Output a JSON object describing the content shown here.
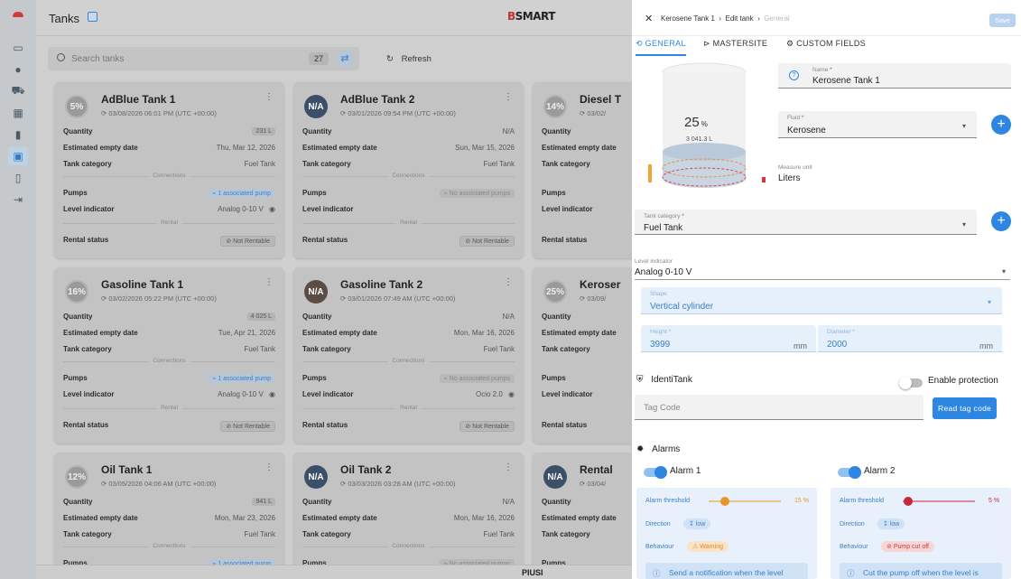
{
  "header": {
    "title": "Tanks",
    "brand_prefix": "B",
    "brand_main": "SMART"
  },
  "search": {
    "placeholder": "Search tanks",
    "count": "27",
    "refresh_label": "Refresh"
  },
  "sidebar": {
    "items": [
      "home-icon",
      "monitor-icon",
      "user-icon",
      "truck-icon",
      "building-icon",
      "chart-icon",
      "tank-icon",
      "map-icon",
      "export-icon"
    ],
    "active_index": 6
  },
  "labels": {
    "quantity": "Quantity",
    "empty_date": "Estimated empty date",
    "category": "Tank category",
    "connections": "Connections",
    "pumps": "Pumps",
    "level": "Level indicator",
    "rental": "Rental",
    "rental_status": "Rental status"
  },
  "cards": [
    {
      "badge": "5%",
      "badge_type": "pct",
      "name": "AdBlue Tank 1",
      "date": "03/08/2026 06:01 PM (UTC +00:00)",
      "quantity": "231 L",
      "empty_date": "Thu, Mar 12, 2026",
      "category": "Fuel Tank",
      "pumps": "1 associated pump",
      "pump_assoc": true,
      "level": "Analog 0-10 V",
      "rental": "Not Rentable"
    },
    {
      "badge": "N/A",
      "badge_type": "na",
      "name": "AdBlue Tank 2",
      "date": "03/01/2026 09:54 PM (UTC +00:00)",
      "quantity": "N/A",
      "empty_date": "Sun, Mar 15, 2026",
      "category": "Fuel Tank",
      "pumps": "No associated pumps",
      "pump_assoc": false,
      "level": "",
      "rental": "Not Rentable"
    },
    {
      "badge": "14%",
      "badge_type": "pct",
      "name": "Diesel T",
      "date": "03/02/",
      "quantity": "",
      "empty_date": "",
      "category": "",
      "pumps": "",
      "pump_assoc": false,
      "level": "",
      "rental": "",
      "partial": true
    },
    {
      "badge": "16%",
      "badge_type": "pct",
      "name": "Gasoline Tank 1",
      "date": "03/02/2026 05:22 PM (UTC +00:00)",
      "quantity": "4 025 L",
      "empty_date": "Tue, Apr 21, 2026",
      "category": "Fuel Tank",
      "pumps": "1 associated pump",
      "pump_assoc": true,
      "level": "Analog 0-10 V",
      "rental": "Not Rentable"
    },
    {
      "badge": "N/A",
      "badge_type": "na brown",
      "name": "Gasoline Tank 2",
      "date": "03/01/2026 07:49 AM (UTC +00:00)",
      "quantity": "N/A",
      "empty_date": "Mon, Mar 16, 2026",
      "category": "Fuel Tank",
      "pumps": "No associated pumps",
      "pump_assoc": false,
      "level": "Ocio 2.0",
      "rental": "Not Rentable"
    },
    {
      "badge": "25%",
      "badge_type": "pct",
      "name": "Keroser",
      "date": "03/09/",
      "quantity": "",
      "empty_date": "",
      "category": "",
      "pumps": "",
      "pump_assoc": false,
      "level": "",
      "rental": "",
      "partial": true
    },
    {
      "badge": "12%",
      "badge_type": "pct",
      "name": "Oil Tank 1",
      "date": "03/05/2026 04:06 AM (UTC +00:00)",
      "quantity": "941 L",
      "empty_date": "Mon, Mar 23, 2026",
      "category": "Fuel Tank",
      "pumps": "1 associated pump",
      "pump_assoc": true,
      "level": "",
      "rental": ""
    },
    {
      "badge": "N/A",
      "badge_type": "na",
      "name": "Oil Tank 2",
      "date": "03/03/2026 03:28 AM (UTC +00:00)",
      "quantity": "N/A",
      "empty_date": "Mon, Mar 16, 2026",
      "category": "Fuel Tank",
      "pumps": "No associated pumps",
      "pump_assoc": false,
      "level": "",
      "rental": ""
    },
    {
      "badge": "N/A",
      "badge_type": "na",
      "name": "Rental",
      "date": "03/04/",
      "quantity": "",
      "empty_date": "",
      "category": "",
      "pumps": "",
      "pump_assoc": false,
      "level": "",
      "rental": "",
      "partial": true
    }
  ],
  "footer": {
    "logo": "PIUSI"
  },
  "panel": {
    "breadcrumb": [
      "Kerosene Tank 1",
      "Edit tank",
      "General"
    ],
    "save_label": "Save",
    "tabs": [
      "GENERAL",
      "MASTERSITE",
      "CUSTOM FIELDS"
    ],
    "tank_visual": {
      "fill_percent": "25",
      "percent_sign": "%",
      "volume": "3 041.3 L"
    },
    "name_label": "Name",
    "name_value": "Kerosene Tank 1",
    "fluid_label": "Fluid",
    "fluid_value": "Kerosene",
    "measure_label": "Measure unit",
    "measure_value": "Liters",
    "category_label": "Tank category",
    "category_value": "Fuel Tank",
    "level_label": "Level indicator",
    "level_value": "Analog 0-10 V",
    "shape_label": "Shape",
    "shape_value": "Vertical cylinder",
    "height_label": "Height",
    "height_value": "3999",
    "height_unit": "mm",
    "diameter_label": "Diameter",
    "diameter_value": "2000",
    "diameter_unit": "mm",
    "identitank_label": "IdentiTank",
    "enable_protection_label": "Enable protection",
    "tag_placeholder": "Tag Code",
    "read_tag_label": "Read tag code",
    "alarms_label": "Alarms",
    "alarms": [
      {
        "name": "Alarm 1",
        "threshold_label": "Alarm threshold",
        "threshold": "15 %",
        "threshold_frac": 0.15,
        "color": "#e8962a",
        "direction_label": "Direction",
        "direction": "low",
        "behaviour_label": "Behaviour",
        "behaviour": "Warning",
        "note": "Send a notification when the level"
      },
      {
        "name": "Alarm 2",
        "threshold_label": "Alarm threshold",
        "threshold": "5 %",
        "threshold_frac": 0.05,
        "color": "#c8283b",
        "direction_label": "Direction",
        "direction": "low",
        "behaviour_label": "Behaviour",
        "behaviour": "Pump cut off",
        "note": "Cut the pump off when the level is"
      }
    ]
  }
}
